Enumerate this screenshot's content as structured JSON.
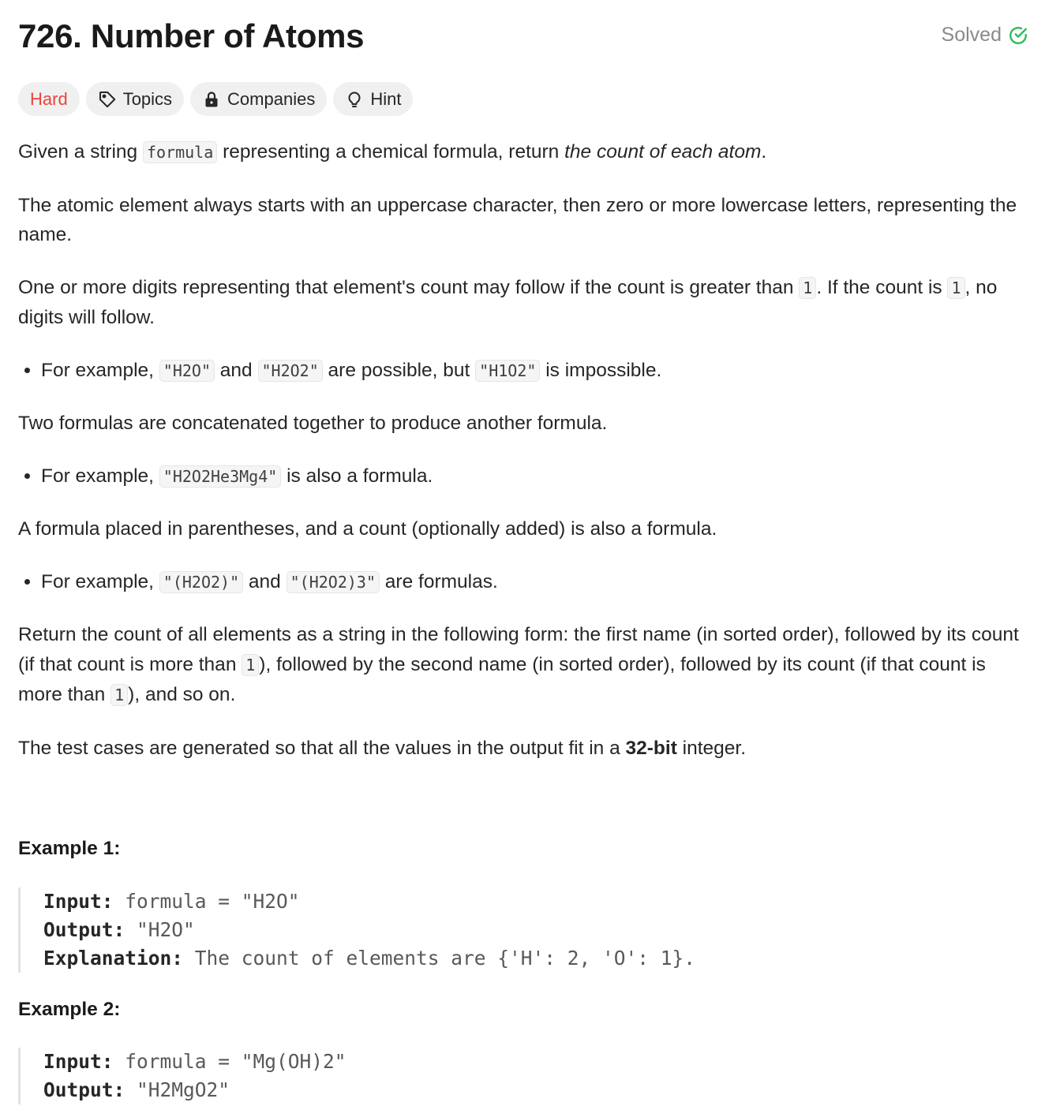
{
  "header": {
    "title": "726. Number of Atoms",
    "status": "Solved",
    "status_color": "#2cbb5d"
  },
  "tags": {
    "difficulty": "Hard",
    "topics": "Topics",
    "companies": "Companies",
    "hint": "Hint",
    "difficulty_color": "#e8453c"
  },
  "description": {
    "p1_a": "Given a string ",
    "p1_code": "formula",
    "p1_b": " representing a chemical formula, return ",
    "p1_em": "the count of each atom",
    "p1_c": ".",
    "p2": "The atomic element always starts with an uppercase character, then zero or more lowercase letters, representing the name.",
    "p3_a": "One or more digits representing that element's count may follow if the count is greater than ",
    "p3_code1": "1",
    "p3_b": ". If the count is ",
    "p3_code2": "1",
    "p3_c": ", no digits will follow.",
    "li1_a": "For example, ",
    "li1_code1": "\"H2O\"",
    "li1_b": " and ",
    "li1_code2": "\"H2O2\"",
    "li1_c": " are possible, but ",
    "li1_code3": "\"H1O2\"",
    "li1_d": " is impossible.",
    "p4": "Two formulas are concatenated together to produce another formula.",
    "li2_a": "For example, ",
    "li2_code": "\"H2O2He3Mg4\"",
    "li2_b": " is also a formula.",
    "p5": "A formula placed in parentheses, and a count (optionally added) is also a formula.",
    "li3_a": "For example, ",
    "li3_code1": "\"(H2O2)\"",
    "li3_b": " and ",
    "li3_code2": "\"(H2O2)3\"",
    "li3_c": " are formulas.",
    "p6_a": "Return the count of all elements as a string in the following form: the first name (in sorted order), followed by its count (if that count is more than ",
    "p6_code1": "1",
    "p6_b": "), followed by the second name (in sorted order), followed by its count (if that count is more than ",
    "p6_code2": "1",
    "p6_c": "), and so on.",
    "p7_a": "The test cases are generated so that all the values in the output fit in a ",
    "p7_strong": "32-bit",
    "p7_b": " integer."
  },
  "examples": [
    {
      "title": "Example 1:",
      "input_label": "Input:",
      "input_value": " formula = \"H2O\"",
      "output_label": "Output:",
      "output_value": " \"H2O\"",
      "explanation_label": "Explanation:",
      "explanation_value": " The count of elements are {'H': 2, 'O': 1}."
    },
    {
      "title": "Example 2:",
      "input_label": "Input:",
      "input_value": " formula = \"Mg(OH)2\"",
      "output_label": "Output:",
      "output_value": " \"H2MgO2\""
    }
  ]
}
